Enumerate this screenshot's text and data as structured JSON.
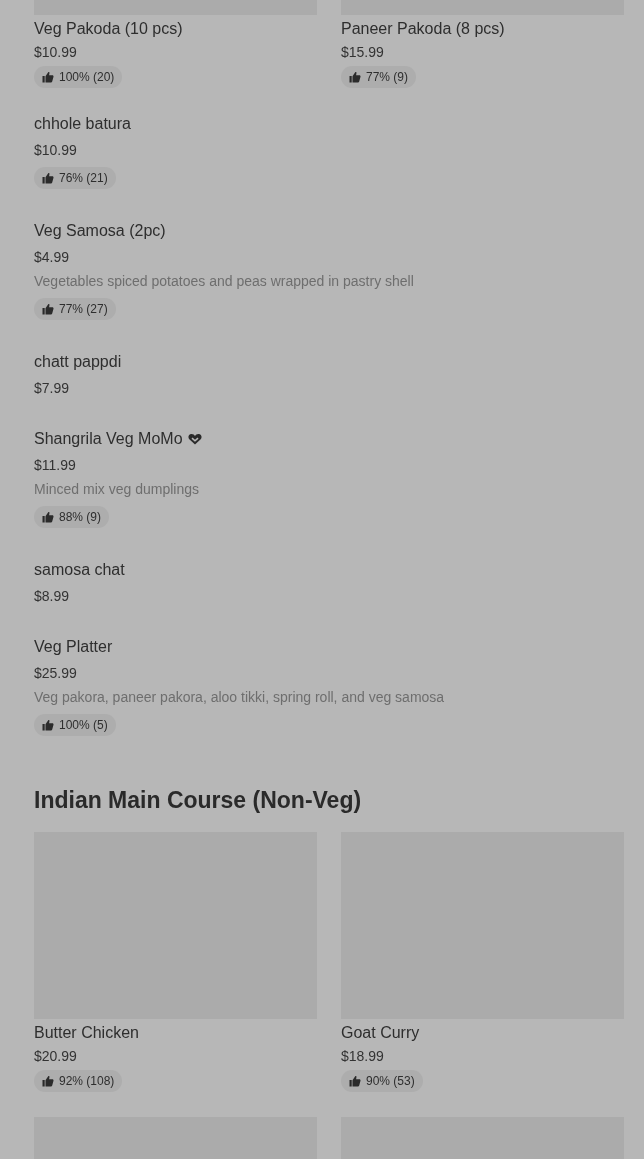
{
  "top_cards": [
    {
      "name": "Veg Pakoda (10 pcs)",
      "price": "$10.99",
      "rating": "100% (20)"
    },
    {
      "name": "Paneer Pakoda (8 pcs)",
      "price": "$15.99",
      "rating": "77% (9)"
    }
  ],
  "items": [
    {
      "name": "chhole batura",
      "price": "$10.99",
      "rating": "76% (21)",
      "favorite": false
    },
    {
      "name": "Veg Samosa (2pc)",
      "price": "$4.99",
      "description": "Vegetables spiced potatoes and peas wrapped in pastry shell",
      "rating": "77% (27)",
      "favorite": false
    },
    {
      "name": "chatt pappdi",
      "price": "$7.99",
      "favorite": false
    },
    {
      "name": "Shangrila Veg MoMo",
      "price": "$11.99",
      "description": "Minced mix veg dumplings",
      "rating": "88% (9)",
      "favorite": true
    },
    {
      "name": "samosa chat",
      "price": "$8.99",
      "favorite": false
    },
    {
      "name": "Veg Platter",
      "price": "$25.99",
      "description": "Veg pakora, paneer pakora, aloo tikki, spring roll, and veg samosa",
      "rating": "100% (5)",
      "favorite": false
    }
  ],
  "section": {
    "title": "Indian Main Course (Non-Veg)",
    "cards": [
      {
        "name": "Butter Chicken",
        "price": "$20.99",
        "rating": "92% (108)"
      },
      {
        "name": "Goat Curry",
        "price": "$18.99",
        "rating": "90% (53)"
      }
    ]
  }
}
